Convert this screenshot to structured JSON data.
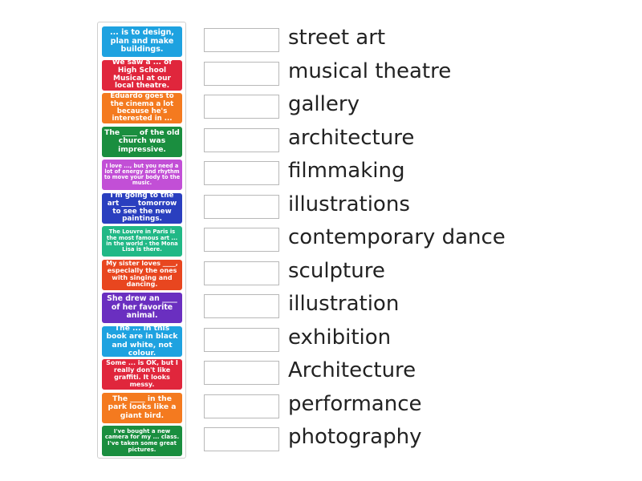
{
  "tiles": [
    {
      "text": "... is to design, plan and make buildings.",
      "color": "#1ea2e0"
    },
    {
      "text": "We saw a ... of High School Musical at our local theatre.",
      "color": "#e0263c"
    },
    {
      "text": "Eduardo goes to the cinema a lot because he's interested in ...",
      "color": "#f47a1f"
    },
    {
      "text": "The ____ of the old church was impressive.",
      "color": "#1a8e3f"
    },
    {
      "text": "I love ..., but you need a lot of energy and rhythm to move your body to the music.",
      "color": "#c24fd6"
    },
    {
      "text": "I'm going to the art ____ tomorrow to see the new paintings.",
      "color": "#2a3fbf"
    },
    {
      "text": "The Louvre in Paris is the most famous art ... in the world - the Mona Lisa is there.",
      "color": "#21b886"
    },
    {
      "text": "My sister loves ____, especially the ones with singing and dancing.",
      "color": "#e8461f"
    },
    {
      "text": "She drew an ____ of her favorite animal.",
      "color": "#6a2fc0"
    },
    {
      "text": "The ... in this book are in black and white, not colour.",
      "color": "#1ea2e0"
    },
    {
      "text": "Some ... is OK, but I really don't like graffiti. It looks messy.",
      "color": "#e0263c"
    },
    {
      "text": "The ____ in the park looks like a giant bird.",
      "color": "#f47a1f"
    },
    {
      "text": "I've bought a new camera for my ... class. I've taken some great pictures.",
      "color": "#1a8e3f"
    }
  ],
  "answers": [
    "street art",
    "musical theatre",
    "gallery",
    "architecture",
    "filmmaking",
    "illustrations",
    "contemporary dance",
    "sculpture",
    "illustration",
    "exhibition",
    "Architecture",
    "performance",
    "photography"
  ]
}
